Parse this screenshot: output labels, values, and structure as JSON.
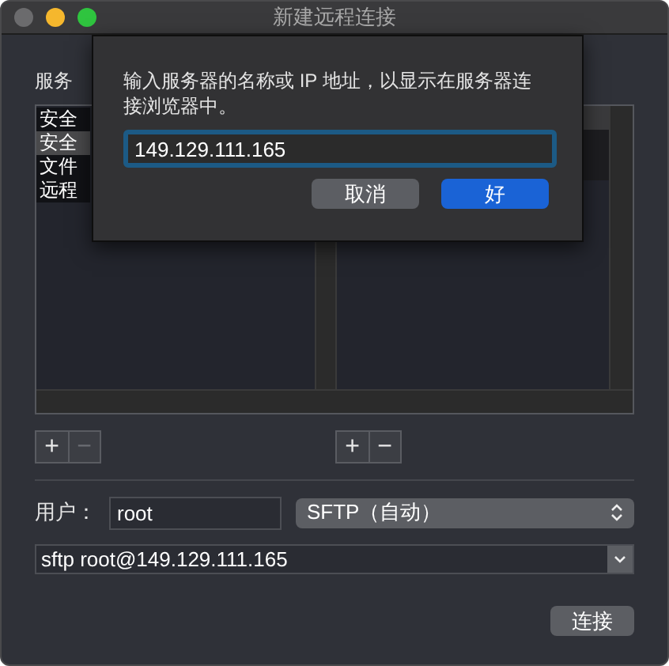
{
  "window": {
    "title": "新建远程连接"
  },
  "services": {
    "label": "服务",
    "items": [
      {
        "label": "安全",
        "selected": false
      },
      {
        "label": "安全",
        "selected": true
      },
      {
        "label": "文件",
        "selected": false
      },
      {
        "label": "远程",
        "selected": false
      }
    ],
    "controls": [
      {
        "symbol": "+",
        "disabled": false
      },
      {
        "symbol": "−",
        "disabled": true
      }
    ]
  },
  "servers": {
    "controls": [
      {
        "symbol": "+",
        "disabled": false
      },
      {
        "symbol": "−",
        "disabled": false
      }
    ]
  },
  "user": {
    "label": "用户：",
    "value": "root"
  },
  "protocol": {
    "value": "SFTP（自动）"
  },
  "command": {
    "value": "sftp root@149.129.111.165"
  },
  "connect_button": "连接",
  "sheet": {
    "message": "输入服务器的名称或 IP 地址，以显示在服务器连接浏览器中。",
    "value": "149.129.111.165",
    "buttons": [
      {
        "label": "取消",
        "kind": "cancel"
      },
      {
        "label": "好",
        "kind": "default"
      }
    ]
  }
}
